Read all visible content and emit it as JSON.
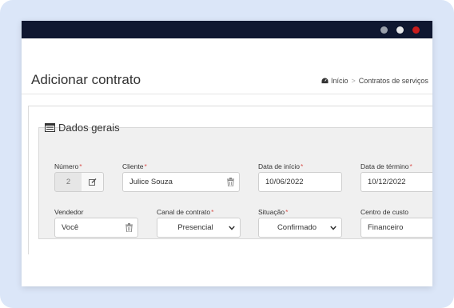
{
  "page": {
    "title": "Adicionar contrato",
    "breadcrumb": [
      "Início",
      "Contratos de serviços"
    ]
  },
  "section": {
    "title": "Dados gerais"
  },
  "fields": {
    "numero": {
      "label": "Número",
      "value": "2"
    },
    "cliente": {
      "label": "Cliente",
      "value": "Julice Souza"
    },
    "data_inicio": {
      "label": "Data de início",
      "value": "10/06/2022"
    },
    "data_termino": {
      "label": "Data de término",
      "value": "10/12/2022"
    },
    "vendedor": {
      "label": "Vendedor",
      "value": "Você"
    },
    "canal": {
      "label": "Canal de contrato",
      "value": "Presencial"
    },
    "situacao": {
      "label": "Situação",
      "value": "Confirmado"
    },
    "centro_custo": {
      "label": "Centro de custo",
      "value": "Financeiro"
    }
  },
  "required_marker": "*",
  "colors": {
    "titlebar": "#0f1730",
    "required": "#d9534f",
    "background": "#dbe6f8"
  }
}
